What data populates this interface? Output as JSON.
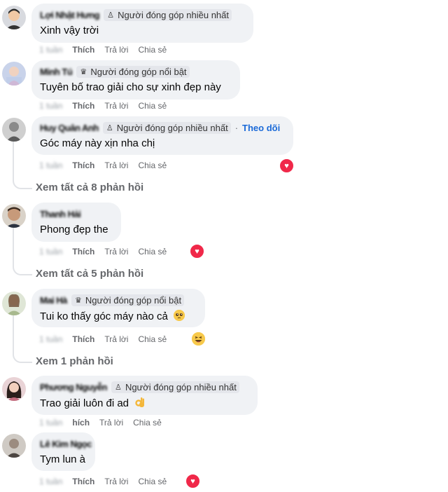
{
  "comments": [
    {
      "name": "Lợi Nhật Hưng",
      "badge": "Người đóng góp nhiều nhất",
      "badge_icon": "contributor-icon",
      "text": "Xinh vậy trời",
      "time": "1 tuần",
      "like": "Thích",
      "reply": "Trả lời",
      "share": "Chia sẻ"
    },
    {
      "name": "Minh Tú",
      "badge": "Người đóng góp nổi bật",
      "badge_icon": "trophy-icon",
      "text": "Tuyên bố trao giải cho sự xinh đẹp này",
      "time": "1 tuần",
      "like": "Thích",
      "reply": "Trả lời",
      "share": "Chia sẻ"
    },
    {
      "name": "Huy Quân Anh",
      "badge": "Người đóng góp nhiều nhất",
      "badge_icon": "contributor-icon",
      "follow": "Theo dõi",
      "text": "Góc máy này xịn nha chị",
      "time": "1 tuần",
      "like": "Thích",
      "reply": "Trả lời",
      "share": "Chia sẻ",
      "view_replies": "Xem tất cả 8 phản hồi"
    },
    {
      "name": "Thanh Hải",
      "text": "Phong đẹp the",
      "time": "1 tuần",
      "like": "Thích",
      "reply": "Trả lời",
      "share": "Chia sẻ",
      "view_replies": "Xem tất cả 5 phản hồi"
    },
    {
      "name": "Mai Hà",
      "badge": "Người đóng góp nổi bật",
      "badge_icon": "trophy-icon",
      "text": "Tui ko thấy góc máy nào cả",
      "time": "1 tuần",
      "like": "Thích",
      "reply": "Trả lời",
      "share": "Chia sẻ",
      "view_replies": "Xem 1 phản hồi"
    },
    {
      "name": "Phương Nguyễn",
      "badge": "Người đóng góp nhiều nhất",
      "badge_icon": "contributor-icon",
      "text": "Trao giải luôn đi ad",
      "time": "1 tuần",
      "like": "hích",
      "reply": "Trả lời",
      "share": "Chia sẻ"
    },
    {
      "name": "Lê Kim Ngọc",
      "text": "Tym lun à",
      "time": "1 tuần",
      "like": "Thích",
      "reply": "Trả lời",
      "share": "Chia sẻ"
    }
  ],
  "colors": {
    "bubble": "#f0f2f5",
    "badge": "#e4e6eb",
    "follow": "#1b6ad8",
    "heart": "#f02849",
    "muted": "#65676b"
  }
}
